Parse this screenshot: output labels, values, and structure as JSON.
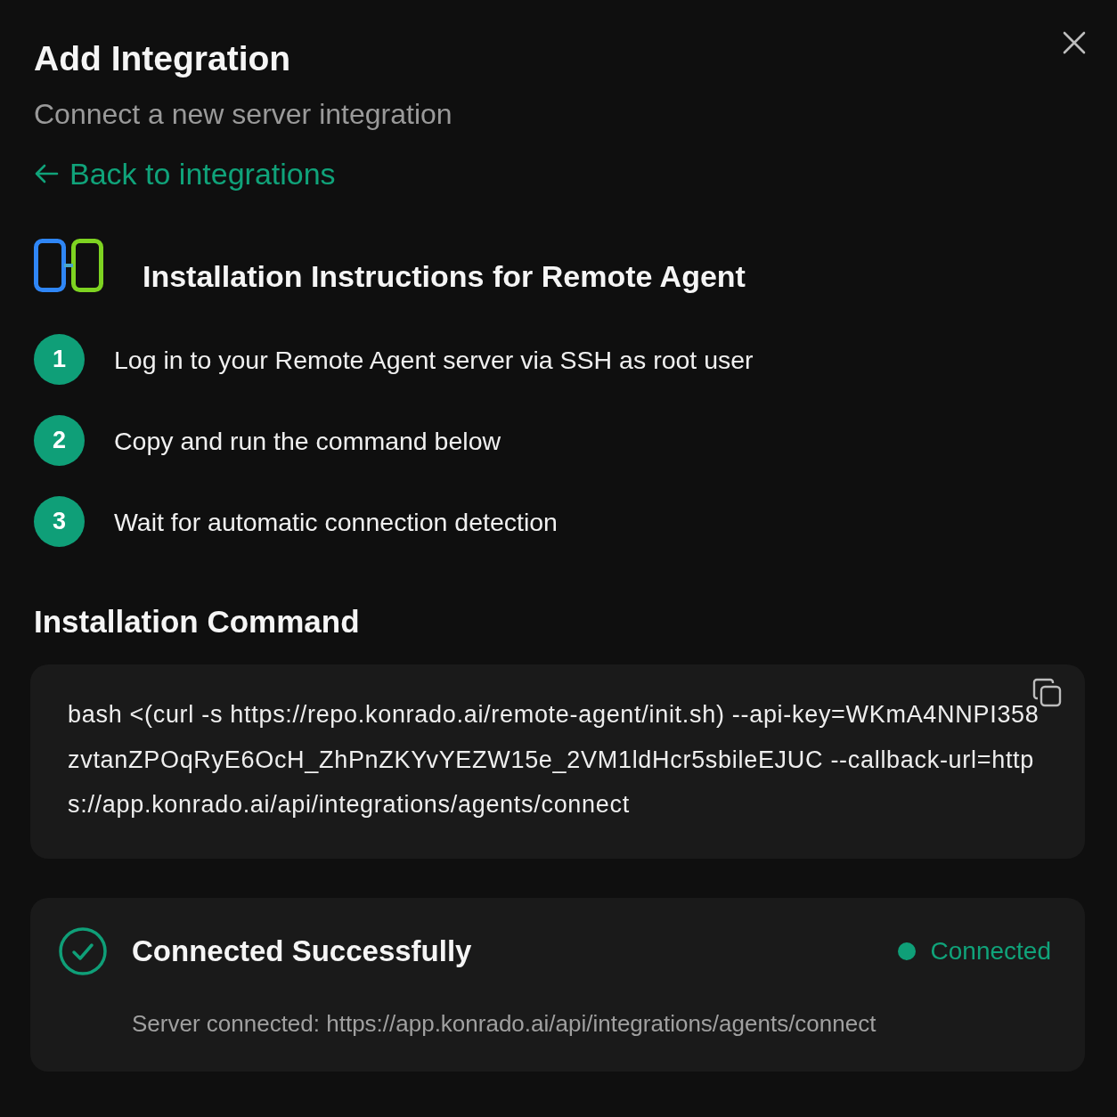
{
  "dialog": {
    "title": "Add Integration",
    "subtitle": "Connect a new server integration",
    "back_link": "Back to integrations"
  },
  "instructions": {
    "heading": "Installation Instructions for Remote Agent",
    "steps": [
      {
        "number": "1",
        "text": "Log in to your Remote Agent server via SSH as root user"
      },
      {
        "number": "2",
        "text": "Copy and run the command below"
      },
      {
        "number": "3",
        "text": "Wait for automatic connection detection"
      }
    ]
  },
  "command": {
    "heading": "Installation Command",
    "text": "bash <(curl -s https://repo.konrado.ai/remote-agent/init.sh) --api-key=WKmA4NNPI358zvtanZPOqRyE6OcH_ZhPnZKYvYEZW15e_2VM1ldHcr5sbileEJUC --callback-url=https://app.konrado.ai/api/integrations/agents/connect"
  },
  "connection": {
    "title": "Connected Successfully",
    "status": {
      "label": "Connected",
      "connected": true
    },
    "detail": "Server connected: https://app.konrado.ai/api/integrations/agents/connect"
  }
}
